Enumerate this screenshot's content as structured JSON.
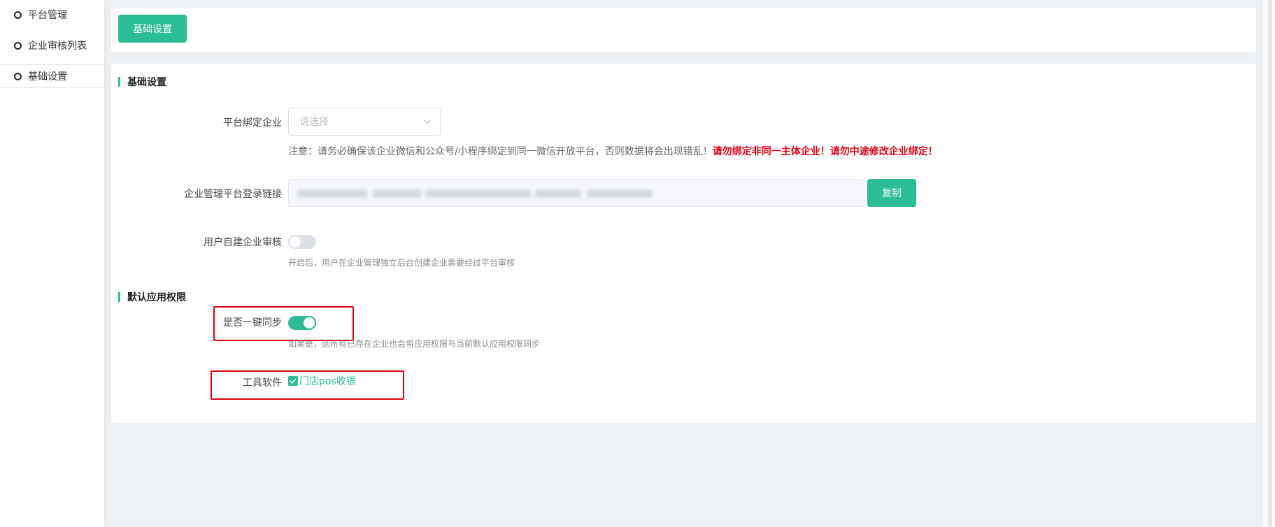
{
  "sidebar": {
    "items": [
      {
        "label": "平台管理"
      },
      {
        "label": "企业审核列表"
      },
      {
        "label": "基础设置"
      }
    ]
  },
  "top_tab": {
    "label": "基础设置"
  },
  "sections": {
    "basic": {
      "title": "基础设置"
    },
    "permissions": {
      "title": "默认应用权限"
    }
  },
  "form": {
    "bind_enterprise": {
      "label": "平台绑定企业",
      "placeholder": "请选择",
      "note_prefix": "注意：请务必确保该企业微信和公众号/小程序绑定到同一微信开放平台，否则数据将会出现错乱！",
      "note_warning": "请勿绑定非同一主体企业！请勿中途修改企业绑定！"
    },
    "login_link": {
      "label": "企业管理平台登录链接",
      "copy_label": "复制"
    },
    "self_build_review": {
      "label": "用户自建企业审核",
      "enabled": false,
      "hint": "开启后，用户在企业管理独立后台创建企业需要经过平台审核"
    },
    "one_key_sync": {
      "label": "是否一键同步",
      "enabled": true,
      "hint": "如果是，则所有已存在企业也会将应用权限与当前默认应用权限同步"
    },
    "tool_software": {
      "label": "工具软件",
      "option": "门店pos收银",
      "checked": true
    }
  },
  "colors": {
    "accent": "#2bbd95",
    "warning": "#e60012",
    "highlight_box": "#e60012"
  }
}
